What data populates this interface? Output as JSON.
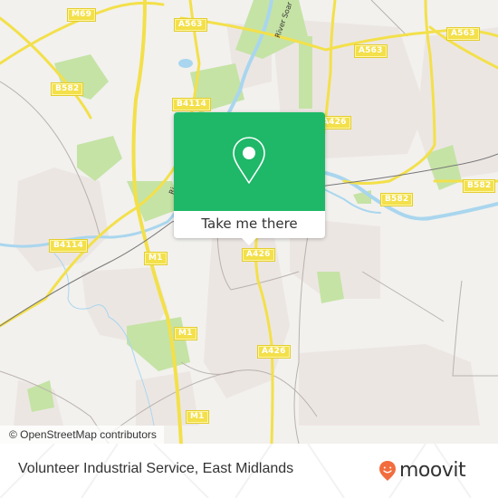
{
  "map": {
    "attribution": "© OpenStreetMap contributors",
    "road_labels": [
      {
        "id": "m69",
        "text": "M69"
      },
      {
        "id": "a563-nw",
        "text": "A563"
      },
      {
        "id": "b582-w",
        "text": "B582"
      },
      {
        "id": "b4114-n",
        "text": "B4114"
      },
      {
        "id": "a563-n",
        "text": "A563"
      },
      {
        "id": "a563-ne",
        "text": "A563"
      },
      {
        "id": "a426-n",
        "text": "A426"
      },
      {
        "id": "b4114-w",
        "text": "B4114"
      },
      {
        "id": "m1-n",
        "text": "M1"
      },
      {
        "id": "b582-c",
        "text": "B582"
      },
      {
        "id": "b582-e",
        "text": "B582"
      },
      {
        "id": "a426-c",
        "text": "A426"
      },
      {
        "id": "m1-c",
        "text": "M1"
      },
      {
        "id": "a426-s",
        "text": "A426"
      },
      {
        "id": "m1-s",
        "text": "M1"
      }
    ],
    "river_labels": [
      {
        "id": "river-soar-n",
        "text": "River Soar"
      },
      {
        "id": "river-soar-w",
        "text": "Ri"
      }
    ],
    "colors": {
      "background": "#f2f1ee",
      "urban": "#ece6e3",
      "park": "#c5e3a5",
      "water": "#a9d6ee",
      "road_major": "#f3e04a",
      "rail": "#777777"
    }
  },
  "popup": {
    "icon": "location-pin-icon",
    "button_label": "Take me there",
    "accent_color": "#1eb868"
  },
  "footer": {
    "place_name": "Volunteer Industrial Service, East Midlands",
    "brand": "moovit",
    "brand_color": "#f26d3d"
  }
}
